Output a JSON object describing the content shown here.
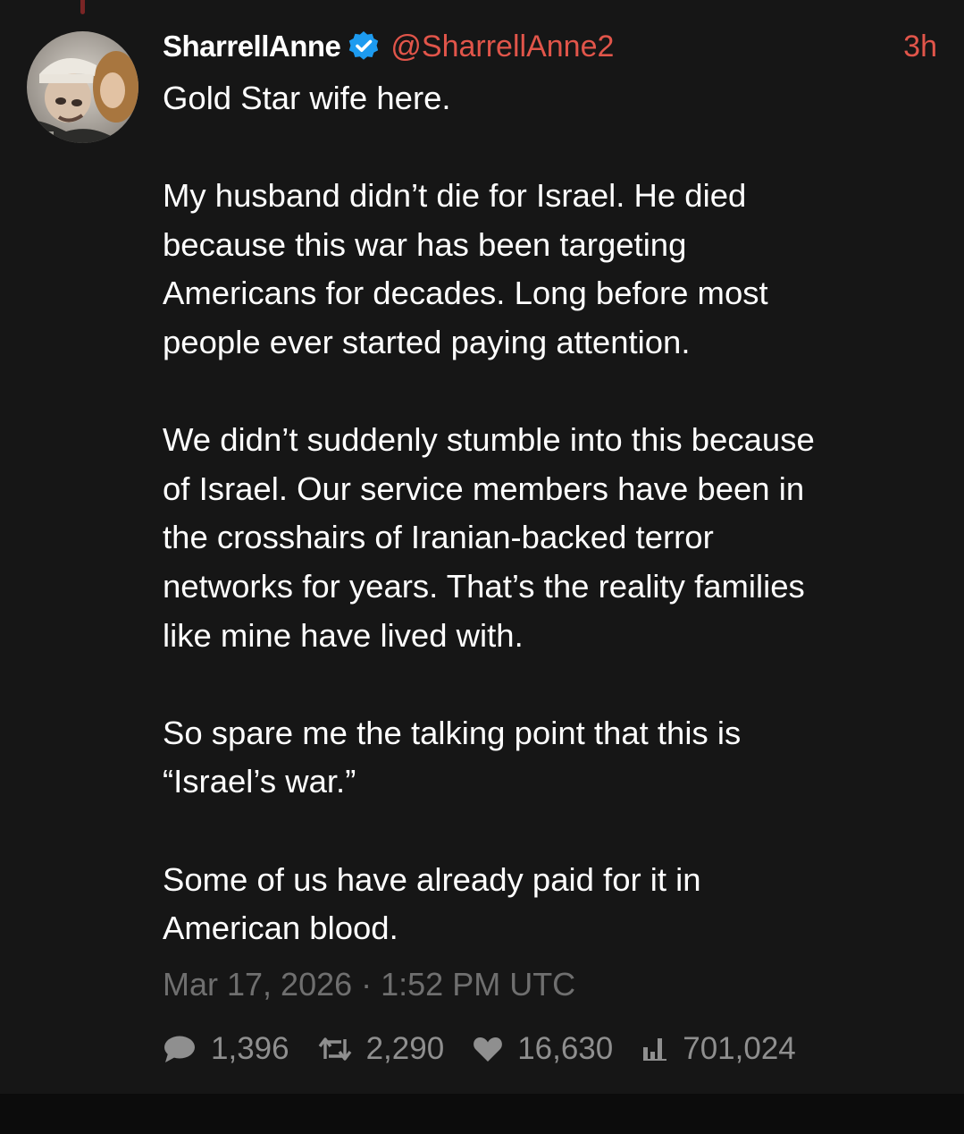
{
  "colors": {
    "accent": "#e1554a",
    "verified": "#1d9bf0",
    "thread_line": "#7a2525"
  },
  "author": {
    "display_name": "SharrellAnne",
    "verified_icon": "verified-badge-icon",
    "handle": "@SharrellAnne2",
    "avatar": "profile-avatar"
  },
  "tweet": {
    "time_ago": "3h",
    "text": "Gold Star wife here.\n\nMy husband didn’t die for Israel. He died\nbecause this war has been targeting\nAmericans for decades. Long before most\npeople ever started paying attention.\n\nWe didn’t suddenly stumble into this because\nof Israel. Our service members have been in\nthe crosshairs of Iranian-backed terror\nnetworks for years. That’s the reality families\nlike mine have lived with.\n\nSo spare me the talking point that this is\n“Israel’s war.”\n\nSome of us have already paid for it in\nAmerican blood.",
    "timestamp": "Mar 17, 2026 · 1:52 PM UTC"
  },
  "stats": {
    "replies": {
      "icon": "comment-icon",
      "count": "1,396"
    },
    "retweets": {
      "icon": "retweet-icon",
      "count": "2,290"
    },
    "likes": {
      "icon": "heart-icon",
      "count": "16,630"
    },
    "views": {
      "icon": "bar-chart-icon",
      "count": "701,024"
    }
  }
}
